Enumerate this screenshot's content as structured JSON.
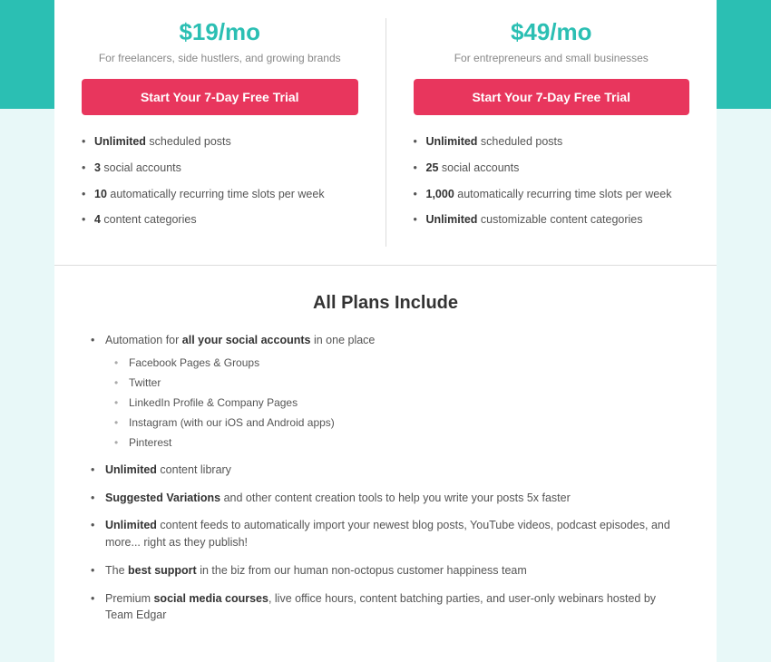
{
  "colors": {
    "teal": "#2bbfb3",
    "pink": "#e8365d",
    "text_dark": "#333",
    "text_medium": "#555",
    "text_light": "#888"
  },
  "plan_left": {
    "price": "$19/mo",
    "description": "For freelancers, side hustlers, and growing brands",
    "cta": "Start Your 7-Day Free Trial",
    "features": [
      {
        "bold": "Unlimited",
        "rest": " scheduled posts"
      },
      {
        "bold": "3",
        "rest": " social accounts"
      },
      {
        "bold": "10",
        "rest": " automatically recurring time slots per week"
      },
      {
        "bold": "4",
        "rest": " content categories"
      }
    ]
  },
  "plan_right": {
    "price": "$49/mo",
    "description": "For entrepreneurs and small businesses",
    "cta": "Start Your 7-Day Free Trial",
    "features": [
      {
        "bold": "Unlimited",
        "rest": " scheduled posts"
      },
      {
        "bold": "25",
        "rest": " social accounts"
      },
      {
        "bold": "1,000",
        "rest": " automatically recurring time slots per week"
      },
      {
        "bold": "Unlimited",
        "rest": " customizable content categories"
      }
    ]
  },
  "all_plans": {
    "title": "All Plans Include",
    "items": [
      {
        "bold": "Automation for ",
        "bold2": "all your social accounts",
        "rest": " in one place",
        "subitems": [
          "Facebook Pages & Groups",
          "Twitter",
          "LinkedIn Profile & Company Pages",
          "Instagram (with our iOS and Android apps)",
          "Pinterest"
        ]
      },
      {
        "bold": "Unlimited",
        "rest": " content library"
      },
      {
        "bold": "Suggested Variations",
        "rest": " and other content creation tools to help you write your posts 5x faster"
      },
      {
        "bold": "Unlimited",
        "rest": " content feeds to automatically import your newest blog posts, YouTube videos, podcast episodes, and more... right as they publish!"
      },
      {
        "rest_start": "The ",
        "bold": "best support",
        "rest": " in the biz from our human non-octopus customer happiness team"
      },
      {
        "rest_start": "Premium ",
        "bold": "social media courses",
        "rest": ", live office hours, content batching parties, and user-only webinars hosted by Team Edgar"
      }
    ]
  }
}
